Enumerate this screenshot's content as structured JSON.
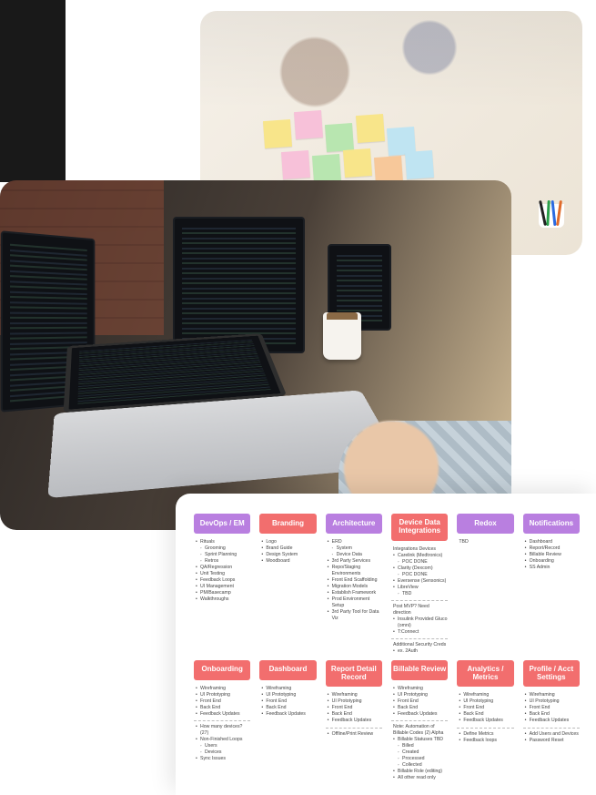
{
  "photos": {
    "top_alt": "Team collaborating around a table covered with colorful sticky notes",
    "mid_alt": "Developer working at a laptop with code on multiple monitors, holding a coffee cup"
  },
  "board": {
    "row1": [
      {
        "header": "DevOps / EM",
        "color": "purple",
        "items": [
          "Rituals",
          "Grooming",
          "Sprint Planning",
          "Retros",
          "QA/Regression",
          "Unit Testing",
          "Feedback Loops",
          "UI Management",
          "PM/Basecamp",
          "Walkthroughs"
        ],
        "subIndex": [
          1,
          2,
          3
        ]
      },
      {
        "header": "Branding",
        "color": "salmon",
        "items": [
          "Logo",
          "Brand Guide",
          "Design System",
          "Moodboard"
        ]
      },
      {
        "header": "Architecture",
        "color": "purple",
        "items": [
          "ERD",
          "System",
          "Device Data",
          "3rd Party Services",
          "Repo/Staging Environments",
          "Front End Scaffolding",
          "Migration Models",
          "Establish Framework",
          "Prod Environment Setup",
          "3rd Party Tool for Data Viz"
        ],
        "subIndex": [
          1,
          2
        ]
      },
      {
        "header": "Device Data Integrations",
        "color": "salmon",
        "preNote": "Integrations Devices",
        "items": [
          "Carelink (Medtronics)",
          "POC DONE",
          "Clarity (Dexcom)",
          "POC DONE",
          "Eversense (Sensonics)",
          "LibreView",
          "TBD"
        ],
        "subIndex": [
          1,
          3,
          6
        ],
        "divider": true,
        "postNote": "Post MVP? Need direction",
        "items2": [
          "Insulink Provided Gluco (omni)",
          "T:Connect"
        ],
        "divider2": true,
        "postNote2": "Additional Security Creds",
        "items3": [
          "ex. 2Auth"
        ]
      },
      {
        "header": "Redox",
        "color": "purple",
        "items": [
          "TBD"
        ],
        "noBullets": true
      },
      {
        "header": "Notifications",
        "color": "purple",
        "items": [
          "Dashboard",
          "Report/Record",
          "Billable Review",
          "Onboarding",
          "SS Admin"
        ]
      }
    ],
    "row2": [
      {
        "header": "Onboarding",
        "color": "salmon",
        "items": [
          "Wireframing",
          "UI Prototyping",
          "Front End",
          "Back End",
          "Feedback Updates"
        ],
        "divider": true,
        "items2": [
          "How many devices? (27)",
          "Non-Finished Loops",
          "Users",
          "Devices",
          "Sync Issues"
        ],
        "subIndex2": [
          2,
          3
        ]
      },
      {
        "header": "Dashboard",
        "color": "salmon",
        "items": [
          "Wireframing",
          "UI Prototyping",
          "Front End",
          "Back End",
          "Feedback Updates"
        ]
      },
      {
        "header": "Report Detail Record",
        "color": "salmon",
        "items": [
          "Wireframing",
          "UI Prototyping",
          "Front End",
          "Back End",
          "Feedback Updates"
        ],
        "divider": true,
        "items2": [
          "Offline/Print Review"
        ]
      },
      {
        "header": "Billable Review",
        "color": "salmon",
        "items": [
          "Wireframing",
          "UI Prototyping",
          "Front End",
          "Back End",
          "Feedback Updates"
        ],
        "postNote": "Note: Automation of Billable Codes (2) Alpha",
        "divider": true,
        "items2": [
          "Billable Statuses TBD",
          "Billed",
          "Created",
          "Processed",
          "Collected",
          "Billable Role (editing)",
          "All other read only"
        ],
        "subIndex2": [
          1,
          2,
          3,
          4
        ]
      },
      {
        "header": "Analytics / Metrics",
        "color": "salmon",
        "items": [
          "Wireframing",
          "UI Prototyping",
          "Front End",
          "Back End",
          "Feedback Updates"
        ],
        "divider": true,
        "items2": [
          "Define Metrics",
          "Feedback loops"
        ]
      },
      {
        "header": "Profile / Acct Settings",
        "color": "salmon",
        "items": [
          "Wireframing",
          "UI Prototyping",
          "Front End",
          "Back End",
          "Feedback Updates"
        ],
        "divider": true,
        "items2": [
          "Add Users and Devices",
          "Password Reset"
        ]
      }
    ]
  }
}
